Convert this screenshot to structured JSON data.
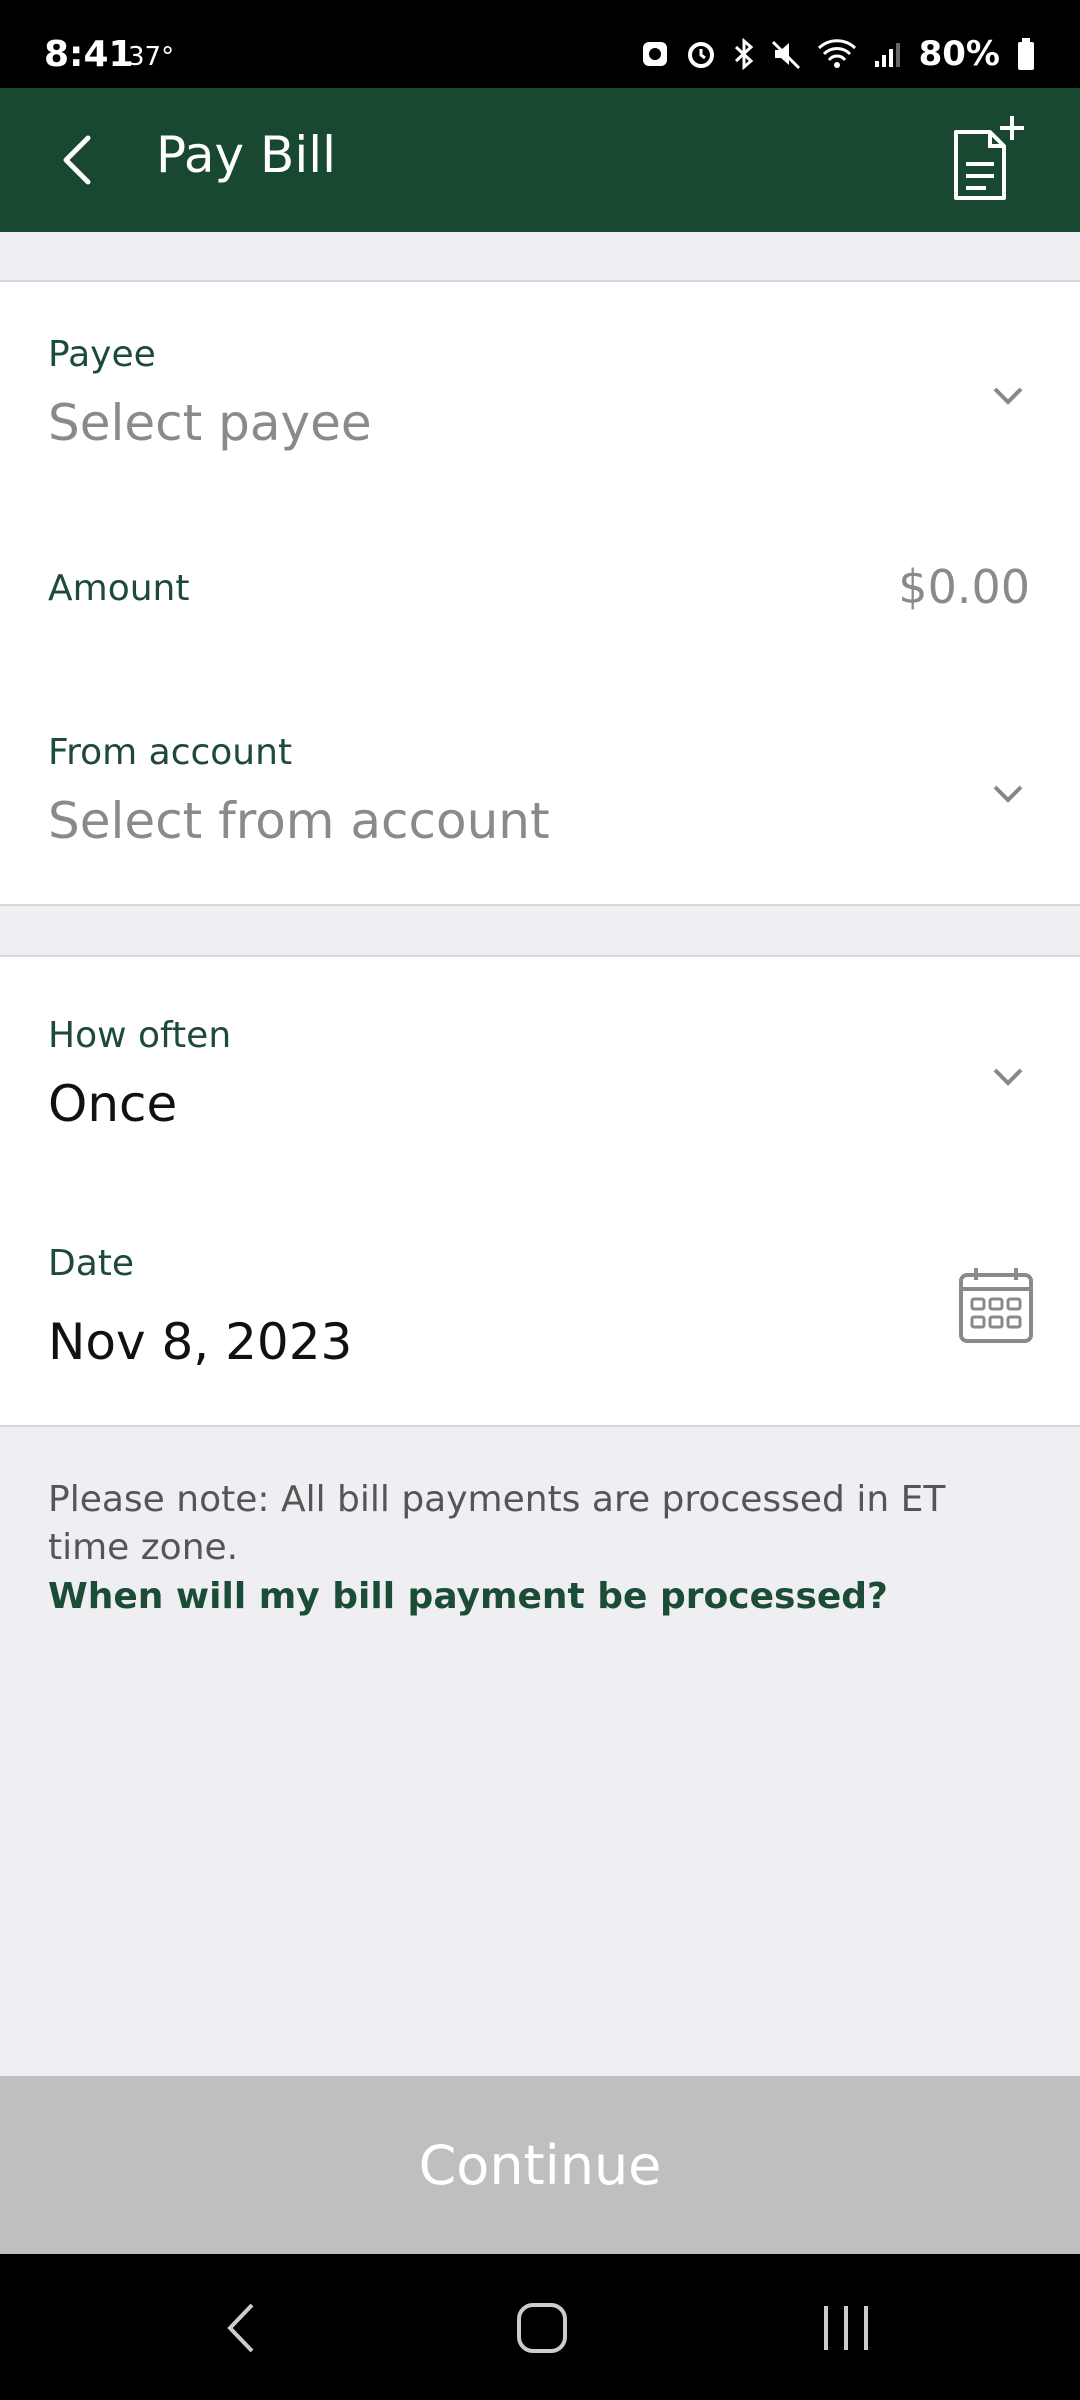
{
  "status": {
    "time": "8:41",
    "temp": "37°",
    "battery": "80%"
  },
  "header": {
    "title": "Pay Bill"
  },
  "form": {
    "payee": {
      "label": "Payee",
      "placeholder": "Select payee"
    },
    "amount": {
      "label": "Amount",
      "value": "$0.00"
    },
    "from_account": {
      "label": "From account",
      "placeholder": "Select from account"
    },
    "how_often": {
      "label": "How often",
      "value": "Once"
    },
    "date": {
      "label": "Date",
      "value": "Nov 8, 2023"
    }
  },
  "note": {
    "text": "Please note: All bill payments are processed in ET time zone.",
    "link": "When will my bill payment be processed?"
  },
  "continue_label": "Continue",
  "colors": {
    "brand": "#184830",
    "label_green": "#1e4b36",
    "disabled_button": "#bfbfbf",
    "background": "#efeef3"
  },
  "icons": [
    "back-arrow-icon",
    "add-bill-icon",
    "chevron-down-icon",
    "calendar-icon"
  ]
}
